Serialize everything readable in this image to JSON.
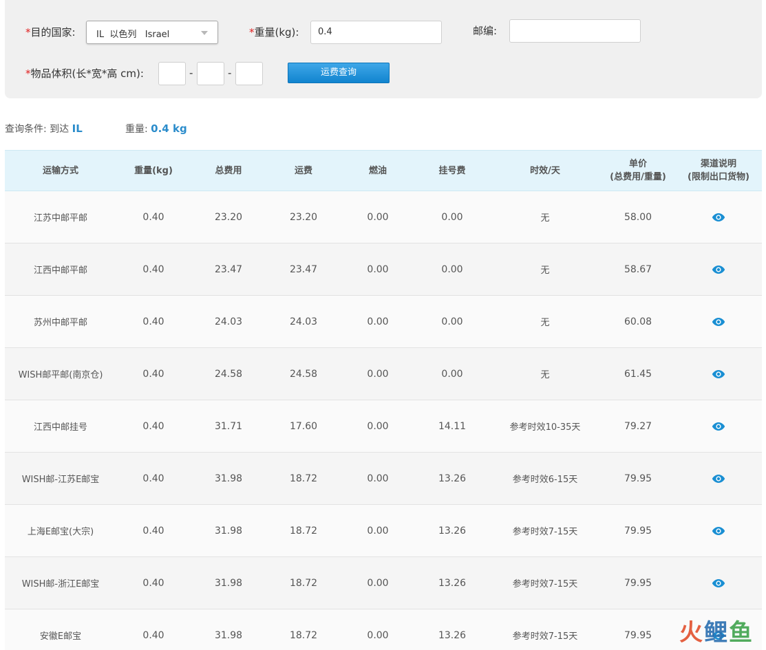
{
  "form": {
    "country_label": "目的国家:",
    "country_value": "IL  以色列   Israel",
    "weight_label": "重量(kg):",
    "weight_value": "0.4",
    "zip_label": "邮编:",
    "zip_value": "",
    "volume_label": "物品体积(长*宽*高 cm):",
    "dim_sep": "-",
    "query_button": "运费查询"
  },
  "conditions": {
    "label": "查询条件: 到达",
    "destination": "IL",
    "weight_label": "重量:",
    "weight": "0.4 kg"
  },
  "table": {
    "headers": {
      "method": "运输方式",
      "weight": "重量(kg)",
      "total": "总费用",
      "freight": "运费",
      "fuel": "燃油",
      "registration": "挂号费",
      "timeliness": "时效/天",
      "unit_price_l1": "单价",
      "unit_price_l2": "(总费用/重量)",
      "channel_l1": "渠道说明",
      "channel_l2": "(限制出口货物)"
    },
    "rows": [
      {
        "method": "江苏中邮平邮",
        "weight": "0.40",
        "total": "23.20",
        "freight": "23.20",
        "fuel": "0.00",
        "reg": "0.00",
        "time": "无",
        "unit": "58.00"
      },
      {
        "method": "江西中邮平邮",
        "weight": "0.40",
        "total": "23.47",
        "freight": "23.47",
        "fuel": "0.00",
        "reg": "0.00",
        "time": "无",
        "unit": "58.67"
      },
      {
        "method": "苏州中邮平邮",
        "weight": "0.40",
        "total": "24.03",
        "freight": "24.03",
        "fuel": "0.00",
        "reg": "0.00",
        "time": "无",
        "unit": "60.08"
      },
      {
        "method": "WISH邮平邮(南京仓)",
        "weight": "0.40",
        "total": "24.58",
        "freight": "24.58",
        "fuel": "0.00",
        "reg": "0.00",
        "time": "无",
        "unit": "61.45"
      },
      {
        "method": "江西中邮挂号",
        "weight": "0.40",
        "total": "31.71",
        "freight": "17.60",
        "fuel": "0.00",
        "reg": "14.11",
        "time": "参考时效10-35天",
        "unit": "79.27"
      },
      {
        "method": "WISH邮-江苏E邮宝",
        "weight": "0.40",
        "total": "31.98",
        "freight": "18.72",
        "fuel": "0.00",
        "reg": "13.26",
        "time": "参考时效6-15天",
        "unit": "79.95"
      },
      {
        "method": "上海E邮宝(大宗)",
        "weight": "0.40",
        "total": "31.98",
        "freight": "18.72",
        "fuel": "0.00",
        "reg": "13.26",
        "time": "参考时效7-15天",
        "unit": "79.95"
      },
      {
        "method": "WISH邮-浙江E邮宝",
        "weight": "0.40",
        "total": "31.98",
        "freight": "18.72",
        "fuel": "0.00",
        "reg": "13.26",
        "time": "参考时效7-15天",
        "unit": "79.95"
      },
      {
        "method": "安徽E邮宝",
        "weight": "0.40",
        "total": "31.98",
        "freight": "18.72",
        "fuel": "0.00",
        "reg": "13.26",
        "time": "参考时效7-15天",
        "unit": "79.95"
      }
    ],
    "channel_icon": "eye-icon"
  },
  "watermark": {
    "part1": "火",
    "part2": "鲤",
    "part3": "鱼"
  },
  "colors": {
    "accent": "#1a8fd3",
    "required": "#e02020",
    "header_bg": "#e3f4fb"
  }
}
